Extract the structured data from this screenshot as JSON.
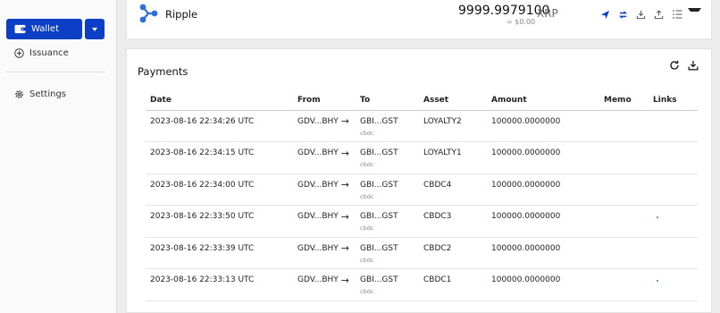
{
  "sidebar": {
    "wallet_label": "Wallet",
    "items": [
      {
        "label": "Issuance",
        "icon": "plus-circle-icon"
      },
      {
        "label": "Settings",
        "icon": "gear-icon"
      }
    ]
  },
  "asset": {
    "name": "Ripple",
    "balance": "9999.9979100",
    "currency": "XRP",
    "usd_value": "= $0.00"
  },
  "payments": {
    "title": "Payments",
    "columns": [
      "Date",
      "From",
      "To",
      "Asset",
      "Amount",
      "Memo",
      "Links"
    ],
    "rows": [
      {
        "date": "2023-08-16 22:34:26 UTC",
        "from": "GDV...BHY",
        "to": "GBI...GST",
        "to_label": "cbdc",
        "asset": "LOYALTY2",
        "amount": "100000.0000000",
        "memo": "",
        "has_link": false
      },
      {
        "date": "2023-08-16 22:34:15 UTC",
        "from": "GDV...BHY",
        "to": "GBI...GST",
        "to_label": "cbdc",
        "asset": "LOYALTY1",
        "amount": "100000.0000000",
        "memo": "",
        "has_link": false
      },
      {
        "date": "2023-08-16 22:34:00 UTC",
        "from": "GDV...BHY",
        "to": "GBI...GST",
        "to_label": "cbdc",
        "asset": "CBDC4",
        "amount": "100000.0000000",
        "memo": "",
        "has_link": false
      },
      {
        "date": "2023-08-16 22:33:50 UTC",
        "from": "GDV...BHY",
        "to": "GBI...GST",
        "to_label": "cbdc",
        "asset": "CBDC3",
        "amount": "100000.0000000",
        "memo": "",
        "has_link": true
      },
      {
        "date": "2023-08-16 22:33:39 UTC",
        "from": "GDV...BHY",
        "to": "GBI...GST",
        "to_label": "cbdc",
        "asset": "CBDC2",
        "amount": "100000.0000000",
        "memo": "",
        "has_link": false
      },
      {
        "date": "2023-08-16 22:33:13 UTC",
        "from": "GDV...BHY",
        "to": "GBI...GST",
        "to_label": "cbdc",
        "asset": "CBDC1",
        "amount": "100000.0000000",
        "memo": "",
        "has_link": true
      }
    ]
  },
  "colors": {
    "primary": "#0d3fc6",
    "ripple_blue": "#2a6fdb"
  }
}
